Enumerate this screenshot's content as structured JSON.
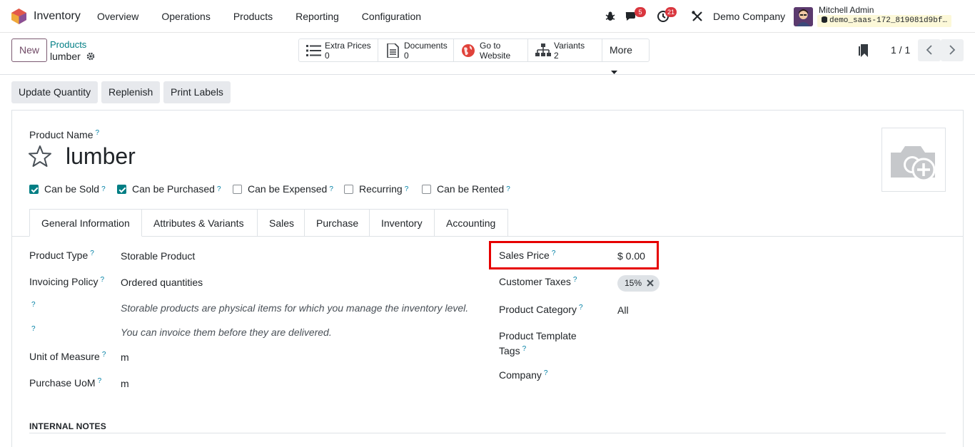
{
  "navbar": {
    "app_name": "Inventory",
    "menu": [
      "Overview",
      "Operations",
      "Products",
      "Reporting",
      "Configuration"
    ],
    "messages_badge": "5",
    "activities_badge": "21",
    "company": "Demo Company",
    "user_name": "Mitchell Admin",
    "db_name": "demo_saas-172_819081d9bf…"
  },
  "control": {
    "new_label": "New",
    "breadcrumb_parent": "Products",
    "breadcrumb_current": "lumber",
    "smart_buttons": [
      {
        "label": "Extra Prices",
        "value": "0"
      },
      {
        "label": "Documents",
        "value": "0"
      },
      {
        "label": "Go to",
        "value": "Website"
      },
      {
        "label": "Variants",
        "value": "2"
      }
    ],
    "more_label": "More",
    "pager": "1 / 1"
  },
  "actions": [
    "Update Quantity",
    "Replenish",
    "Print Labels"
  ],
  "form": {
    "product_name_label": "Product Name",
    "product_name": "lumber",
    "help_mark": "?",
    "checkboxes": [
      {
        "label": "Can be Sold",
        "checked": true
      },
      {
        "label": "Can be Purchased",
        "checked": true
      },
      {
        "label": "Can be Expensed",
        "checked": false
      },
      {
        "label": "Recurring",
        "checked": false
      },
      {
        "label": "Can be Rented",
        "checked": false
      }
    ],
    "tabs": [
      "General Information",
      "Attributes & Variants",
      "Sales",
      "Purchase",
      "Inventory",
      "Accounting"
    ],
    "left": {
      "product_type_label": "Product Type",
      "product_type": "Storable Product",
      "invoicing_policy_label": "Invoicing Policy",
      "invoicing_policy": "Ordered quantities",
      "hint_storable": "Storable products are physical items for which you manage the inventory level.",
      "hint_invoice": "You can invoice them before they are delivered.",
      "uom_label": "Unit of Measure",
      "uom": "m",
      "purchase_uom_label": "Purchase UoM",
      "purchase_uom": "m"
    },
    "right": {
      "sales_price_label": "Sales Price",
      "sales_price": "$ 0.00",
      "customer_taxes_label": "Customer Taxes",
      "tax_tag": "15%",
      "product_category_label": "Product Category",
      "product_category": "All",
      "template_tags_label_1": "Product Template",
      "template_tags_label_2": "Tags",
      "company_label": "Company"
    },
    "internal_notes": "INTERNAL NOTES"
  },
  "colors": {
    "brand": "#714b67",
    "teal": "#017e84",
    "badge": "#d9363e",
    "highlight": "#e60000"
  }
}
